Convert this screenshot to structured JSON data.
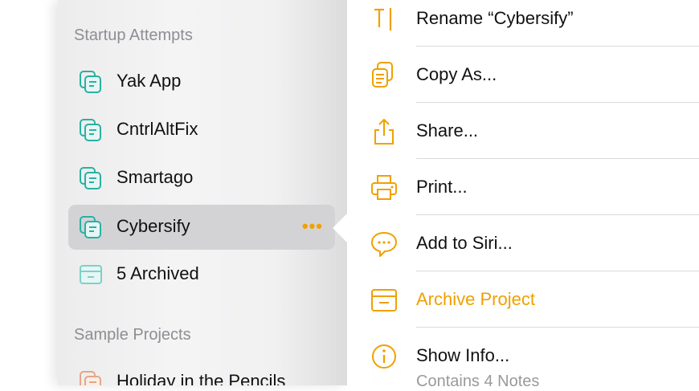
{
  "sidebar": {
    "sections": [
      {
        "title": "Startup Attempts",
        "items": [
          {
            "label": "Yak App",
            "icon": "notes-stack-icon"
          },
          {
            "label": "CntrlAltFix",
            "icon": "notes-stack-icon"
          },
          {
            "label": "Smartago",
            "icon": "notes-stack-icon"
          },
          {
            "label": "Cybersify",
            "icon": "notes-stack-icon",
            "selected": true,
            "more": "•••"
          },
          {
            "label": "5 Archived",
            "icon": "archive-box-icon"
          }
        ]
      },
      {
        "title": "Sample Projects",
        "items": [
          {
            "label": "Holiday in the Pencils",
            "icon": "notes-stack-icon"
          }
        ]
      }
    ]
  },
  "menu": {
    "items": [
      {
        "label": "Rename “Cybersify”",
        "icon": "text-cursor-icon"
      },
      {
        "label": "Copy As...",
        "icon": "copy-documents-icon"
      },
      {
        "label": "Share...",
        "icon": "share-icon"
      },
      {
        "label": "Print...",
        "icon": "printer-icon"
      },
      {
        "label": "Add to Siri...",
        "icon": "siri-bubble-icon"
      },
      {
        "label": "Archive Project",
        "icon": "archive-box-icon",
        "accent": true
      },
      {
        "label": "Show Info...",
        "icon": "info-circle-icon",
        "sublabel": "Contains 4 Notes"
      }
    ]
  },
  "colors": {
    "teal": "#2bb0a3",
    "accent": "#f0a000",
    "peach": "#e5a685"
  }
}
